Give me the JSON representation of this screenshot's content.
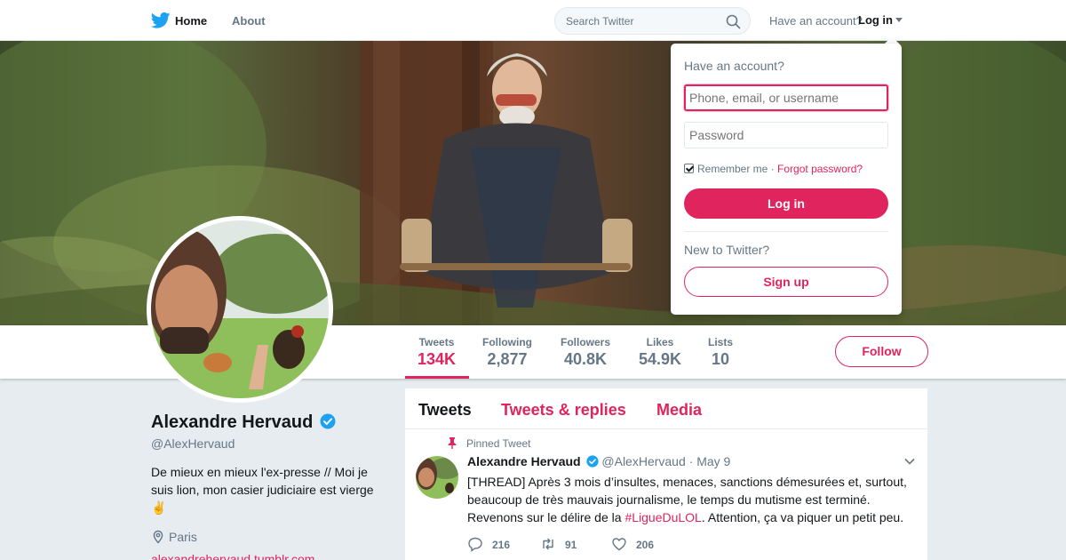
{
  "colors": {
    "accent": "#e0245e",
    "brand_bird": "#1da1f2",
    "muted": "#657786"
  },
  "nav": {
    "home": "Home",
    "about": "About",
    "search_placeholder": "Search Twitter",
    "have_account": "Have an account?",
    "login": "Log in"
  },
  "profile": {
    "name": "Alexandre Hervaud",
    "handle": "@AlexHervaud",
    "bio": "De mieux en mieux l'ex-presse // Moi je suis lion, mon casier judiciaire est vierge ✌️",
    "location": "Paris",
    "website": "alexandrehervaud.tumblr.com",
    "follow": "Follow"
  },
  "stats": [
    {
      "label": "Tweets",
      "value": "134K"
    },
    {
      "label": "Following",
      "value": "2,877"
    },
    {
      "label": "Followers",
      "value": "40.8K"
    },
    {
      "label": "Likes",
      "value": "54.9K"
    },
    {
      "label": "Lists",
      "value": "10"
    }
  ],
  "timeline": {
    "tabs": [
      "Tweets",
      "Tweets & replies",
      "Media"
    ],
    "tweet": {
      "pinned_label": "Pinned Tweet",
      "author": "Alexandre Hervaud",
      "handle": "@AlexHervaud",
      "date": "· May 9",
      "text_before": "[THREAD] Après 3 mois d’insultes, menaces, sanctions démesurées et, surtout, beaucoup de très mauvais journalisme, le temps du mutisme est terminé. Revenons sur le délire de la ",
      "hashtag": "#LigueDuLOL",
      "text_after": ". Attention, ça va piquer un petit peu.",
      "replies": "216",
      "retweets": "91",
      "likes": "206"
    }
  },
  "login_dropdown": {
    "title": "Have an account?",
    "username_placeholder": "Phone, email, or username",
    "password_placeholder": "Password",
    "remember": "Remember me",
    "separator": "·",
    "forgot": "Forgot password?",
    "login_button": "Log in",
    "new_to": "New to Twitter?",
    "signup_button": "Sign up"
  }
}
